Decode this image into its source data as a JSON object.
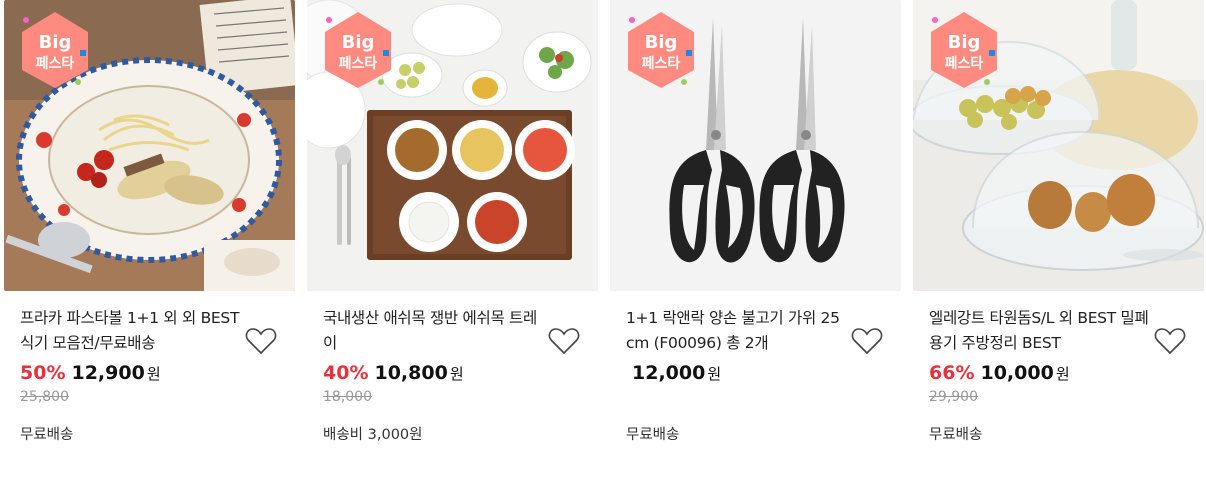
{
  "badge": {
    "line1": "Big",
    "line2": "페스타"
  },
  "products": [
    {
      "title": "프라카 파스타볼 1+1 외 외 BEST 식기 모음전/무료배송",
      "discount": "50%",
      "price": "12,900",
      "currency": "원",
      "original_price": "25,800",
      "shipping": "무료배송",
      "image_icon": "pasta-plate-image"
    },
    {
      "title": "국내생산 애쉬목 쟁반 에쉬목 트레이",
      "discount": "40%",
      "price": "10,800",
      "currency": "원",
      "original_price": "18,000",
      "shipping": "배송비 3,000원",
      "image_icon": "wooden-tray-image"
    },
    {
      "title": "1+1 락앤락 양손 불고기 가위 25cm (F00096) 총 2개",
      "discount": "",
      "price": "12,000",
      "currency": "원",
      "original_price": "",
      "shipping": "무료배송",
      "image_icon": "scissors-image"
    },
    {
      "title": "엘레강트 타원돔S/L 외 BEST 밀폐용기 주방정리 BEST",
      "discount": "66%",
      "price": "10,000",
      "currency": "원",
      "original_price": "29,900",
      "shipping": "무료배송",
      "image_icon": "glass-dome-image"
    }
  ],
  "colors": {
    "discount": "#e8313c",
    "badge": "#ff8a80",
    "badge_text": "#ffffff"
  }
}
